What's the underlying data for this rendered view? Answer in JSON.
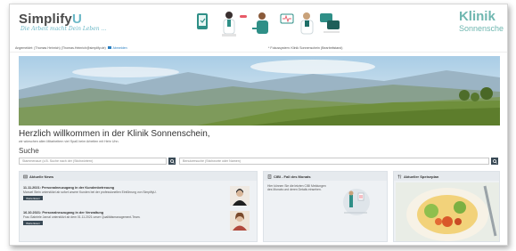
{
  "header": {
    "brand_main": "Simplify",
    "brand_u": "U",
    "tagline": "Die Arbeit macht Dein Leben ...",
    "clinic_line1": "Klinik",
    "clinic_line2": "Sonnensche"
  },
  "infobar": {
    "text": "Angemeldet: (Thomas Heinrich) (Thomas.Heinrich@simplify.de)",
    "link": "Abmelden",
    "mid": "* Fokussystem: Klinik Sonnenschein (Bearbeitstand)"
  },
  "welcome": {
    "title": "Herzlich willkommen in der Klinik Sonnenschein,",
    "subtitle": "wir wünschen allen Mitarbeitern viel Spaß beim Arbeiten mit Hehr Uhn.",
    "search_label": "Suche",
    "search_placeholder_1": "Stammenaue (z.B. Suche nach der (Stichwörtern)",
    "search_placeholder_2": "Benutzersuche (Stichworte oder Namen)"
  },
  "cards": {
    "news": {
      "title": "Aktuelle News",
      "items": [
        {
          "title": "11.11.2021: Personalneuzugang in der Kundenbetreuung",
          "text": "Manuel Stein unterstützt ab sofort unsere Kunden bei der professionellen Einführung von SimplifyU.",
          "button": "Weiterlesen"
        },
        {
          "title": "16.10.2021: Personalneuzugang in der Verwaltung",
          "text": "Frau Gabriele Jarnal unterstützt ab dem 01.11.2021 unser Qualitätsmanagement-Team.",
          "button": "Weiterlesen"
        }
      ]
    },
    "cibi": {
      "title": "CIBI - Fall des Monats",
      "text": "Hier können Sie die letzten CIBI Meldungen des Monats und deren Details einsehen."
    },
    "meal": {
      "title": "Aktueller Speiseplan"
    }
  },
  "colors": {
    "accent": "#6fb7b0",
    "brand_blue": "#6bb8c7",
    "dark_button": "#3a4a56",
    "card_bg": "#eef1f4"
  }
}
